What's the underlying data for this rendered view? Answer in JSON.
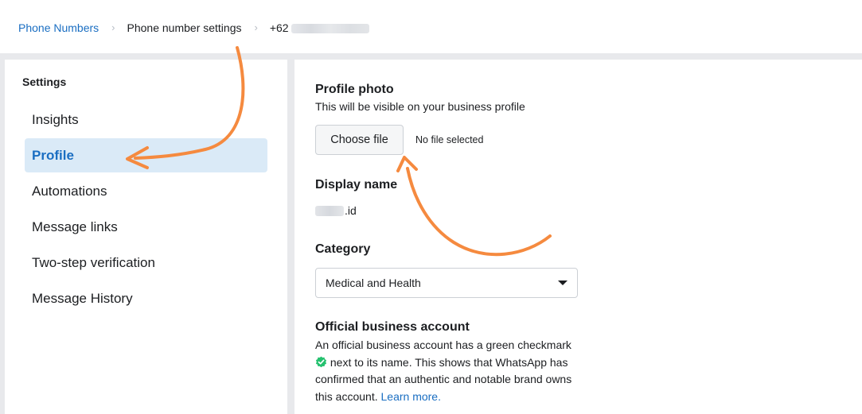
{
  "breadcrumb": {
    "root": "Phone Numbers",
    "settings": "Phone number settings",
    "number_prefix": "+62"
  },
  "sidebar": {
    "title": "Settings",
    "items": [
      {
        "label": "Insights",
        "active": false
      },
      {
        "label": "Profile",
        "active": true
      },
      {
        "label": "Automations",
        "active": false
      },
      {
        "label": "Message links",
        "active": false
      },
      {
        "label": "Two-step verification",
        "active": false
      },
      {
        "label": "Message History",
        "active": false
      }
    ]
  },
  "profile_photo": {
    "heading": "Profile photo",
    "description": "This will be visible on your business profile",
    "choose_button": "Choose file",
    "file_status": "No file selected"
  },
  "display_name": {
    "heading": "Display name",
    "value_suffix": ".id"
  },
  "category": {
    "heading": "Category",
    "selected": "Medical and Health"
  },
  "official": {
    "heading": "Official business account",
    "text_before": "An official business account has a green checkmark",
    "text_after": "next to its name. This shows that WhatsApp has confirmed that an authentic and notable brand owns this account.",
    "learn_more": "Learn more."
  },
  "colors": {
    "accent": "#1a6ec2",
    "active_bg": "#daeaf7",
    "annotation_arrow": "#f58a3f",
    "checkmark": "#25c16f"
  },
  "icons": {
    "breadcrumb_separator": "chevron-right-icon",
    "dropdown": "caret-down-icon",
    "verified": "verified-check-icon"
  }
}
